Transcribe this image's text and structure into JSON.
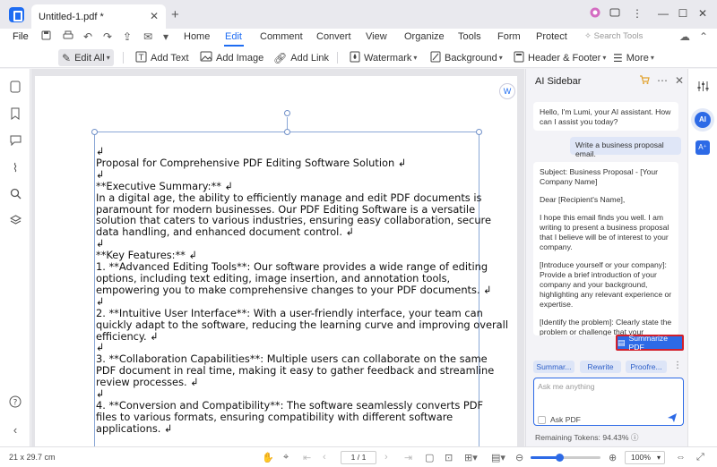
{
  "window": {
    "tab_title": "Untitled-1.pdf *",
    "tab_close": "✕",
    "tab_add": "+",
    "controls": {
      "minimize": "—",
      "maximize": "☐",
      "close": "✕"
    }
  },
  "menu": {
    "file": "File",
    "items": [
      "Home",
      "Edit",
      "Comment",
      "Convert",
      "View",
      "Organize",
      "Tools",
      "Form",
      "Protect"
    ],
    "active": "Edit",
    "search_placeholder": "Search Tools"
  },
  "toolbar": {
    "edit_all": "Edit All",
    "add_text": "Add Text",
    "add_image": "Add Image",
    "add_link": "Add Link",
    "watermark": "Watermark",
    "background": "Background",
    "header_footer": "Header & Footer",
    "more": "More"
  },
  "document": {
    "lines": [
      "↲",
      "Proposal for Comprehensive PDF Editing Software Solution ↲",
      "↲",
      "**Executive Summary:** ↲",
      "In a digital age, the ability to efficiently manage and edit PDF documents is",
      "paramount for modern businesses. Our PDF Editing Software is a versatile",
      "solution that caters to various industries, ensuring easy collaboration, secure",
      "data handling, and enhanced document control. ↲",
      "↲",
      "**Key Features:** ↲",
      "1. **Advanced Editing Tools**: Our software provides a wide range of editing",
      "options, including text editing, image insertion, and annotation tools,",
      "empowering you to make comprehensive changes to your PDF documents. ↲",
      "↲",
      "2. **Intuitive User Interface**: With a user-friendly interface, your team can",
      "quickly adapt to the software, reducing the learning curve and improving overall",
      "efficiency. ↲",
      "↲",
      "3. **Collaboration Capabilities**: Multiple users can collaborate on the same",
      "PDF document in real time, making it easy to gather feedback and streamline",
      "review processes. ↲",
      "↲",
      "4. **Conversion and Compatibility**: The software seamlessly converts PDF",
      "files to various formats, ensuring compatibility with different software",
      "applications. ↲"
    ]
  },
  "ai_sidebar": {
    "title": "AI Sidebar",
    "greeting": "Hello, I'm Lumi, your AI assistant. How can I assist you today?",
    "user_message": "Write a business proposal email.",
    "response_paragraphs": [
      "Subject: Business Proposal - [Your Company Name]",
      "Dear [Recipient's Name],",
      "I hope this email finds you well. I am writing to present a business proposal that I believe will be of interest to your company.",
      "[Introduce yourself or your company]: Provide a brief introduction of your company and your background, highlighting any relevant experience or expertise.",
      "[Identify the problem]: Clearly state the problem or challenge that your"
    ],
    "summarize_button": "Summarize PDF",
    "chips": [
      "Summar...",
      "Rewrite",
      "Proofre..."
    ],
    "ask_placeholder": "Ask me anything",
    "ask_pdf": "Ask PDF",
    "remaining_tokens": "Remaining Tokens: 94.43%"
  },
  "statusbar": {
    "page_size": "21 x 29.7 cm",
    "page_indicator": "1 / 1",
    "zoom_level": "100%",
    "zoom_slider_fraction": 0.41
  },
  "colors": {
    "accent": "#1e6cf2",
    "summarize_border": "#d21f2b"
  }
}
